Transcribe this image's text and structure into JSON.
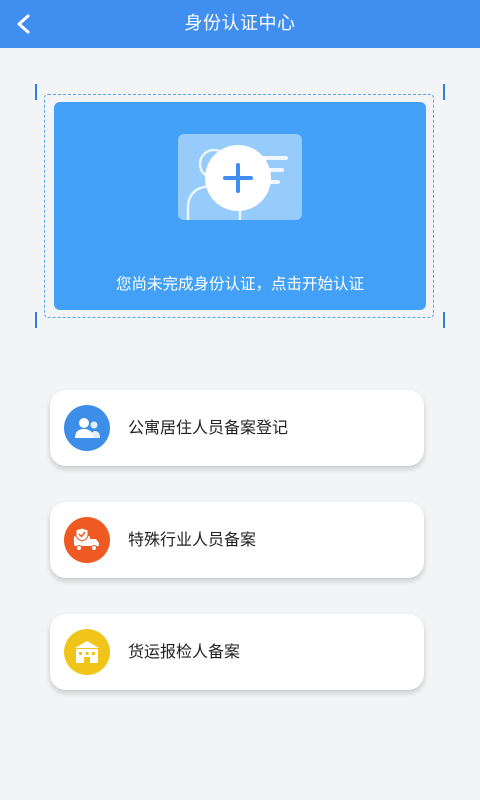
{
  "header": {
    "title": "身份认证中心",
    "back_icon": "chevron-left-icon"
  },
  "id_card": {
    "prompt": "您尚未完成身份认证，点击开始认证",
    "icon": "add-id-card-icon"
  },
  "menu": {
    "items": [
      {
        "label": "公寓居住人员备案登记",
        "icon": "people-icon",
        "color": "#3d8ee8"
      },
      {
        "label": "特殊行业人员备案",
        "icon": "truck-shield-icon",
        "color": "#ef5a23"
      },
      {
        "label": "货运报检人备案",
        "icon": "building-icon",
        "color": "#f0c419"
      }
    ]
  },
  "colors": {
    "primary": "#3f8ef0",
    "card_blue": "#42a1f7",
    "background": "#f3f4f6"
  }
}
